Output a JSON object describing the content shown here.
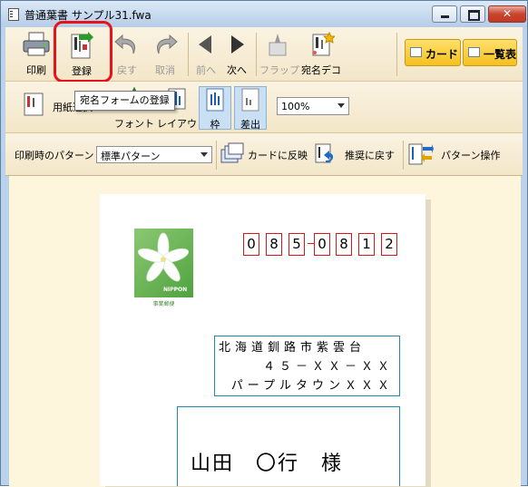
{
  "window": {
    "title": "普通葉書 サンプル31.fwa",
    "close_glyph": "✕"
  },
  "toolbar_main": {
    "print": "印刷",
    "register": "登録",
    "back": "戻す",
    "cancel": "取消",
    "prev": "前へ",
    "next": "次へ",
    "flap": "フラップ",
    "deco": "宛名デコ",
    "card": "カード",
    "list": "一覧表"
  },
  "tooltip": "宛名フォームの登録",
  "toolbar_layout": {
    "paper_select": "用紙選択",
    "font": "フォント",
    "layout": "レイアウト",
    "frame": "枠",
    "sender": "差出",
    "zoom": "100%"
  },
  "toolbar_pattern": {
    "label": "印刷時のパターン",
    "pattern_value": "標準パターン",
    "reflect_card": "カードに反映",
    "revert": "推奨に戻す",
    "pattern_ops": "パターン操作"
  },
  "postcard": {
    "postal_digits": [
      "0",
      "8",
      "5",
      "0",
      "8",
      "1",
      "2"
    ],
    "stamp_label": "NIPPON",
    "stamp_caption": "事業郵便",
    "address_line1": "北海道釧路市紫雲台",
    "address_line2": "４５－ＸＸ－ＸＸ",
    "address_line3": "パープルタウンＸＸＸ",
    "recipient": "山田　〇行　様"
  }
}
